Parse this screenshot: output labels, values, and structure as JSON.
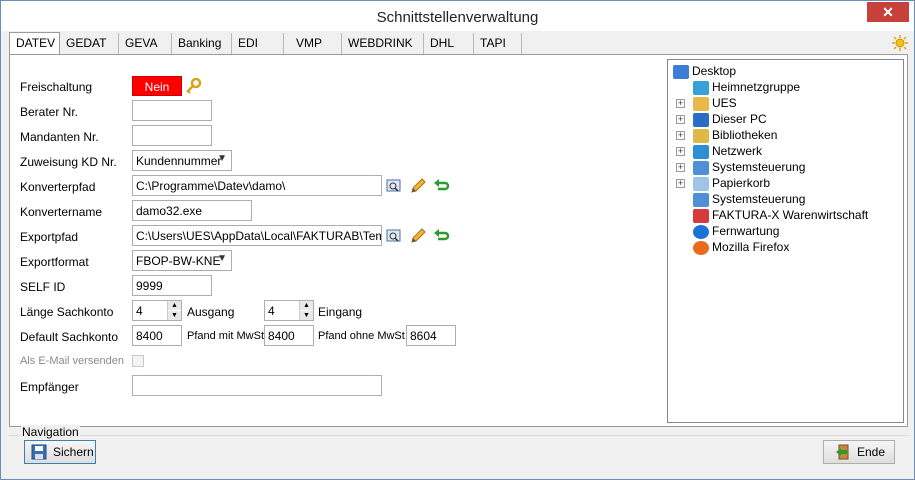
{
  "window": {
    "title": "Schnittstellenverwaltung",
    "close_label": "✕"
  },
  "tabs": [
    "DATEV",
    "GEDAT",
    "GEVA",
    "Banking",
    "EDI",
    "VMP",
    "WEBDRINK",
    "DHL",
    "TAPI"
  ],
  "form": {
    "freischaltung_label": "Freischaltung",
    "freischaltung_value": "Nein",
    "berater_label": "Berater Nr.",
    "berater_value": "",
    "mandanten_label": "Mandanten Nr.",
    "mandanten_value": "",
    "zuweisung_label": "Zuweisung KD Nr.",
    "zuweisung_value": "Kundennummer",
    "konverterpfad_label": "Konverterpfad",
    "konverterpfad_value": "C:\\Programme\\Datev\\damo\\",
    "konvertername_label": "Konvertername",
    "konvertername_value": "damo32.exe",
    "exportpfad_label": "Exportpfad",
    "exportpfad_value": "C:\\Users\\UES\\AppData\\Local\\FAKTURAB\\Templ",
    "exportformat_label": "Exportformat",
    "exportformat_value": "FBOP-BW-KNE",
    "selfid_label": "SELF ID",
    "selfid_value": "9999",
    "laenge_label": "Länge Sachkonto",
    "ausgang_value": "4",
    "ausgang_label": "Ausgang",
    "eingang_value": "4",
    "eingang_label": "Eingang",
    "default_label": "Default Sachkonto",
    "default_value": "8400",
    "pfand_mit_label": "Pfand mit MwSt.",
    "pfand_mit_value": "8400",
    "pfand_ohne_label": "Pfand ohne MwSt.",
    "pfand_ohne_value": "8604",
    "email_label": "Als E-Mail versenden",
    "empfaenger_label": "Empfänger",
    "empfaenger_value": ""
  },
  "tree": [
    {
      "label": "Desktop",
      "icon": "desktop-icon",
      "level": 0,
      "expander": false
    },
    {
      "label": "Heimnetzgruppe",
      "icon": "homegroup-icon",
      "level": 1,
      "expander": false
    },
    {
      "label": "UES",
      "icon": "user-folder-icon",
      "level": 1,
      "expander": true
    },
    {
      "label": "Dieser PC",
      "icon": "computer-icon",
      "level": 1,
      "expander": true
    },
    {
      "label": "Bibliotheken",
      "icon": "libraries-icon",
      "level": 1,
      "expander": true
    },
    {
      "label": "Netzwerk",
      "icon": "network-icon",
      "level": 1,
      "expander": true
    },
    {
      "label": "Systemsteuerung",
      "icon": "control-panel-icon",
      "level": 1,
      "expander": true
    },
    {
      "label": "Papierkorb",
      "icon": "recycle-bin-icon",
      "level": 1,
      "expander": true
    },
    {
      "label": "Systemsteuerung",
      "icon": "control-panel-icon",
      "level": 1,
      "expander": false
    },
    {
      "label": "FAKTURA-X Warenwirtschaft",
      "icon": "faktura-icon",
      "level": 1,
      "expander": false
    },
    {
      "label": "Fernwartung",
      "icon": "teamviewer-icon",
      "level": 1,
      "expander": false
    },
    {
      "label": "Mozilla Firefox",
      "icon": "firefox-icon",
      "level": 1,
      "expander": false
    }
  ],
  "navigation": {
    "legend": "Navigation",
    "save_label": "Sichern",
    "exit_label": "Ende"
  }
}
